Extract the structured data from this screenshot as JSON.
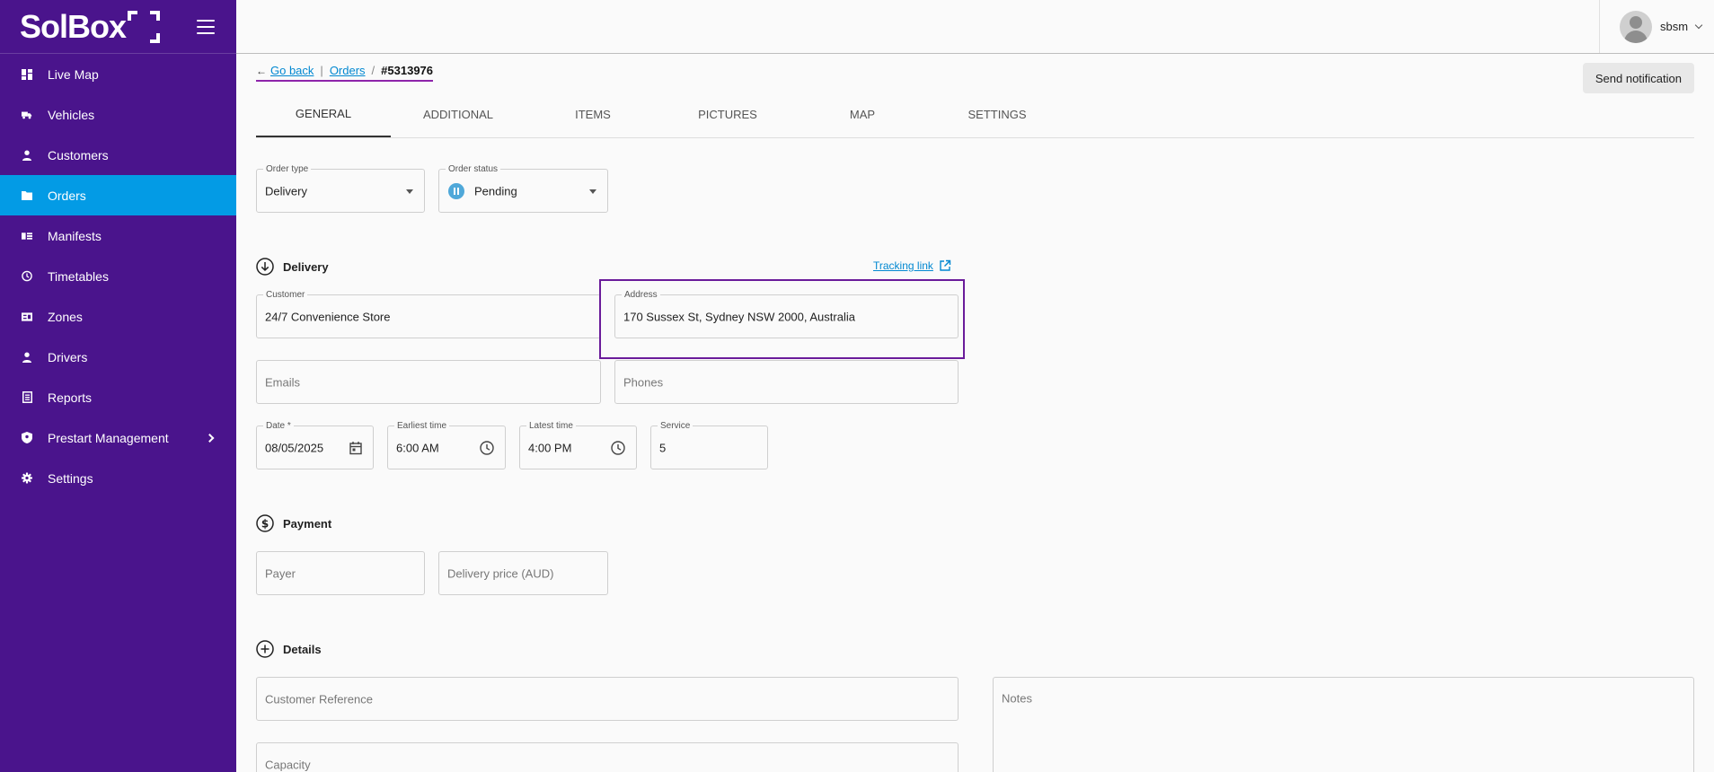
{
  "app": {
    "logo_text": "SolBox",
    "brand_color": "#4a148c",
    "active_color": "#039be5"
  },
  "sidebar": {
    "items": [
      {
        "label": "Live Map",
        "icon": "dashboard-icon"
      },
      {
        "label": "Vehicles",
        "icon": "truck-icon"
      },
      {
        "label": "Customers",
        "icon": "person-icon"
      },
      {
        "label": "Orders",
        "icon": "folder-icon",
        "active": true
      },
      {
        "label": "Manifests",
        "icon": "manifest-icon"
      },
      {
        "label": "Timetables",
        "icon": "clock-icon"
      },
      {
        "label": "Zones",
        "icon": "zones-icon"
      },
      {
        "label": "Drivers",
        "icon": "person-icon"
      },
      {
        "label": "Reports",
        "icon": "report-icon"
      },
      {
        "label": "Prestart Management",
        "icon": "shield-icon",
        "has_submenu": true
      },
      {
        "label": "Settings",
        "icon": "gear-icon"
      }
    ]
  },
  "header": {
    "username": "sbsm"
  },
  "breadcrumb": {
    "back": "Go back",
    "orders": "Orders",
    "current": "#5313976"
  },
  "actions": {
    "send_notification": "Send notification"
  },
  "tabs": [
    {
      "label": "GENERAL",
      "active": true
    },
    {
      "label": "ADDITIONAL"
    },
    {
      "label": "ITEMS"
    },
    {
      "label": "PICTURES"
    },
    {
      "label": "MAP"
    },
    {
      "label": "SETTINGS"
    }
  ],
  "order": {
    "type_label": "Order type",
    "type_value": "Delivery",
    "status_label": "Order status",
    "status_value": "Pending",
    "status_color": "#4fa8d9"
  },
  "delivery": {
    "title": "Delivery",
    "tracking_link": "Tracking link",
    "customer_label": "Customer",
    "customer_value": "24/7 Convenience Store",
    "address_label": "Address",
    "address_value": "170 Sussex St, Sydney NSW 2000, Australia",
    "emails_placeholder": "Emails",
    "phones_placeholder": "Phones",
    "date_label": "Date *",
    "date_value": "08/05/2025",
    "earliest_label": "Earliest time",
    "earliest_value": "6:00 AM",
    "latest_label": "Latest time",
    "latest_value": "4:00 PM",
    "service_label": "Service",
    "service_value": "5"
  },
  "payment": {
    "title": "Payment",
    "payer_placeholder": "Payer",
    "price_placeholder": "Delivery price (AUD)"
  },
  "details": {
    "title": "Details",
    "customer_reference_placeholder": "Customer Reference",
    "notes_placeholder": "Notes",
    "capacity_placeholder": "Capacity"
  }
}
